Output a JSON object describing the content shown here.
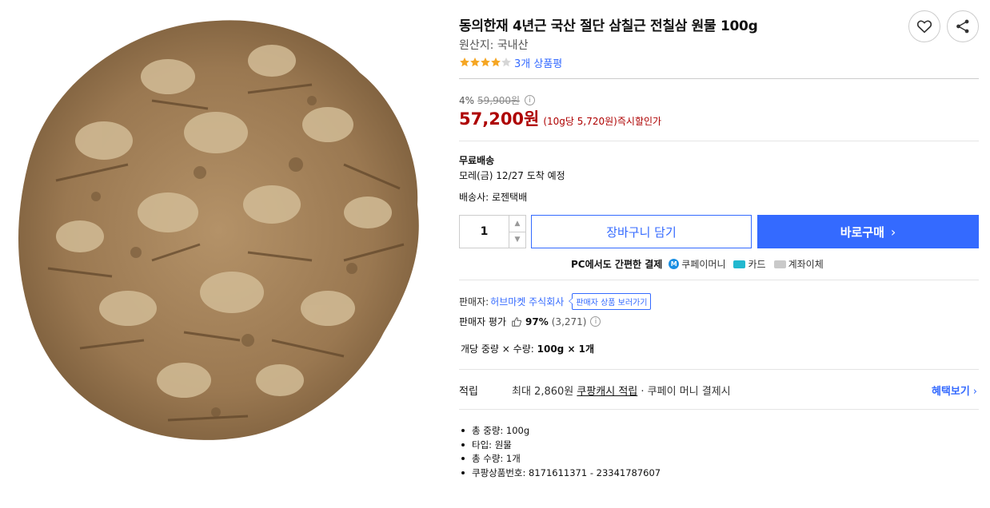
{
  "product": {
    "title": "동의한재 4년근 국산 절단 삼칠근 전칠삼 원물 100g",
    "origin": "원산지: 국내산",
    "rating_stars": 4,
    "review_count": "3개 상품평",
    "image_icon": "dried-root-product-image"
  },
  "actions": {
    "wishlist_icon": "heart-icon",
    "share_icon": "share-icon"
  },
  "price": {
    "discount_rate": "4%",
    "original_price": "59,900원",
    "info_icon": "i",
    "sale_price": "57,200원",
    "unit_price": "(10g당 5,720원)",
    "instant_label": "즉시할인가"
  },
  "shipping": {
    "title": "무료배송",
    "arrival": "모레(금) 12/27 도착 예정",
    "carrier": "배송사: 로젠택배"
  },
  "purchase": {
    "quantity": "1",
    "qty_up": "▲",
    "qty_down": "▼",
    "cart_label": "장바구니 담기",
    "buy_label": "바로구매",
    "buy_chevron": "›"
  },
  "payment": {
    "title": "PC에서도 간편한 결제",
    "coupay_badge": "M",
    "options": [
      "쿠페이머니",
      "카드",
      "계좌이체"
    ]
  },
  "seller": {
    "label": "판매자:",
    "name": "허브마켓 주식회사",
    "tooltip": "판매자 상품 보러가기",
    "rating_label": "판매자 평가",
    "rating_pct": "97%",
    "rating_count": "(3,271)",
    "rating_info": "i"
  },
  "option": {
    "label": "개당 중량 × 수량:",
    "value": "100g × 1개"
  },
  "reward": {
    "label": "적립",
    "prefix": "최대 2,860원",
    "link": "쿠팡캐시 적립",
    "suffix": "· 쿠페이 머니 결제시",
    "benefit_label": "혜택보기",
    "benefit_chevron": "›"
  },
  "specs": [
    "총 중량: 100g",
    "타입: 원물",
    "총 수량: 1개",
    "쿠팡상품번호: 8171611371 - 23341787607"
  ],
  "colors": {
    "accent_blue": "#346aff",
    "price_red": "#ae0000",
    "star_orange": "#f5a623"
  }
}
